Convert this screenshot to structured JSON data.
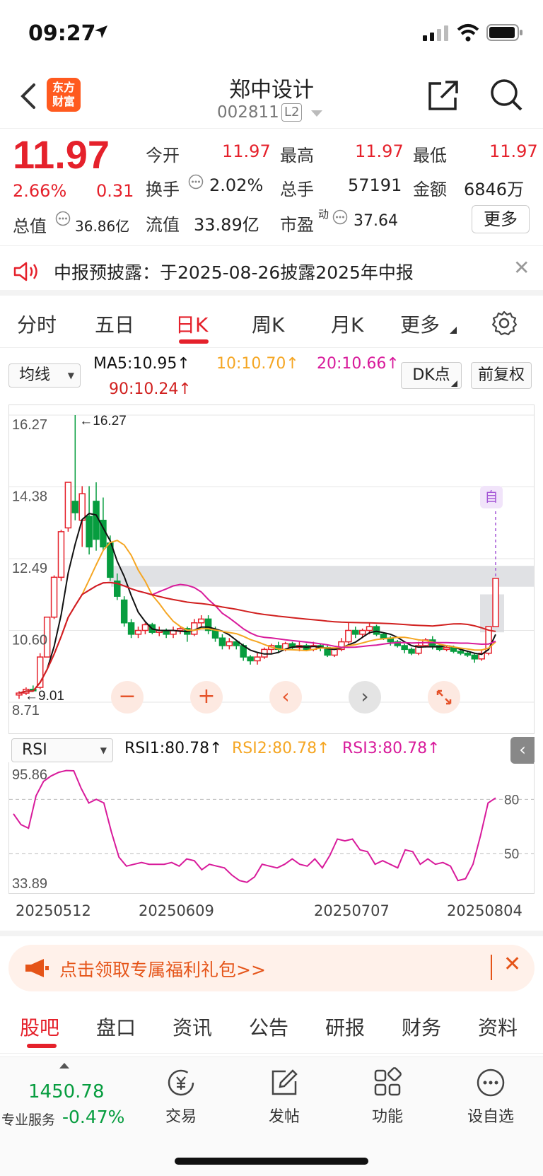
{
  "status": {
    "time": "09:27"
  },
  "header": {
    "title": "郑中设计",
    "code": "002811",
    "level": "L2",
    "logo_line1": "东方",
    "logo_line2": "财富"
  },
  "quote": {
    "price": "11.97",
    "change_pct": "2.66%",
    "change": "0.31",
    "open_label": "今开",
    "open": "11.97",
    "high_label": "最高",
    "high": "11.97",
    "low_label": "最低",
    "low": "11.97",
    "turnover_label": "换手",
    "turnover": "2.02%",
    "volume_label": "总手",
    "volume": "57191",
    "amount_label": "金额",
    "amount": "6846万",
    "total_cap_label": "总值",
    "total_cap": "36.86亿",
    "float_cap_label": "流值",
    "float_cap": "33.89亿",
    "pe_label": "市盈",
    "pe_sup": "动",
    "pe": "37.64",
    "more_label": "更多"
  },
  "notice": {
    "text": "中报预披露：于2025-08-26披露2025年中报"
  },
  "tabs": [
    "分时",
    "五日",
    "日K",
    "周K",
    "月K",
    "更多"
  ],
  "ma": {
    "selector": "均线",
    "ma5": "MA5:10.95↑",
    "ma10": "10:10.70↑",
    "ma20": "20:10.66↑",
    "ma90": "90:10.24↑",
    "dk_label": "DK点",
    "fq_label": "前复权"
  },
  "colors": {
    "up": "#e5212b",
    "down": "#079d3f",
    "ma5": "#111111",
    "ma10": "#f5a623",
    "ma20": "#d81b9b",
    "ma90": "#d1201f"
  },
  "chart_data": [
    {
      "type": "candlestick",
      "title": "",
      "y_ticks": [
        "16.27",
        "14.38",
        "12.49",
        "10.60",
        "8.71"
      ],
      "ylim": [
        8.71,
        16.27
      ],
      "high_mark": "←16.27",
      "low_mark": "←9.01",
      "x_ticks": [
        "20250512",
        "20250609",
        "20250707",
        "20250804"
      ],
      "candles": [
        [
          8.9,
          8.95,
          8.8,
          9.0
        ],
        [
          8.95,
          9.05,
          8.9,
          9.1
        ],
        [
          9.05,
          9.01,
          9.01,
          9.15
        ],
        [
          9.1,
          9.9,
          9.05,
          10.0
        ],
        [
          9.9,
          10.95,
          9.9,
          10.95
        ],
        [
          10.95,
          12.0,
          10.9,
          12.05
        ],
        [
          12.0,
          13.2,
          11.9,
          13.25
        ],
        [
          13.3,
          14.5,
          13.2,
          14.5
        ],
        [
          14.0,
          13.7,
          13.5,
          16.27
        ],
        [
          13.5,
          14.2,
          12.8,
          14.4
        ],
        [
          13.6,
          12.8,
          12.6,
          14.4
        ],
        [
          14.0,
          13.0,
          12.7,
          14.5
        ],
        [
          13.5,
          12.8,
          12.7,
          14.1
        ],
        [
          12.9,
          12.0,
          11.9,
          13.1
        ],
        [
          11.9,
          11.5,
          11.4,
          12.1
        ],
        [
          11.4,
          10.8,
          10.7,
          11.5
        ],
        [
          10.8,
          10.5,
          10.4,
          10.9
        ],
        [
          10.5,
          10.6,
          10.4,
          10.7
        ],
        [
          10.6,
          10.75,
          10.5,
          10.8
        ],
        [
          10.75,
          10.55,
          10.5,
          10.8
        ],
        [
          10.55,
          10.6,
          10.45,
          10.7
        ],
        [
          10.6,
          10.5,
          10.4,
          10.65
        ],
        [
          10.5,
          10.6,
          10.4,
          10.7
        ],
        [
          10.6,
          10.65,
          10.5,
          10.7
        ],
        [
          10.65,
          10.5,
          10.3,
          10.7
        ],
        [
          10.5,
          10.8,
          10.45,
          10.9
        ],
        [
          10.8,
          10.9,
          10.7,
          11.0
        ],
        [
          10.9,
          10.6,
          10.5,
          11.0
        ],
        [
          10.6,
          10.4,
          10.3,
          10.7
        ],
        [
          10.4,
          10.2,
          10.1,
          10.5
        ],
        [
          10.2,
          10.3,
          10.1,
          10.4
        ],
        [
          10.3,
          10.2,
          10.1,
          10.35
        ],
        [
          10.2,
          9.9,
          9.8,
          10.25
        ],
        [
          9.9,
          9.8,
          9.7,
          9.95
        ],
        [
          9.8,
          9.9,
          9.7,
          10.0
        ],
        [
          9.9,
          10.1,
          9.85,
          10.15
        ],
        [
          10.1,
          10.2,
          10.0,
          10.25
        ],
        [
          10.2,
          10.1,
          10.0,
          10.3
        ],
        [
          10.1,
          10.25,
          10.05,
          10.3
        ],
        [
          10.25,
          10.15,
          10.1,
          10.3
        ],
        [
          10.15,
          10.2,
          10.05,
          10.3
        ],
        [
          10.2,
          10.1,
          10.05,
          10.25
        ],
        [
          10.1,
          10.2,
          10.05,
          10.3
        ],
        [
          10.2,
          10.15,
          10.05,
          10.25
        ],
        [
          10.15,
          9.95,
          9.9,
          10.2
        ],
        [
          9.95,
          10.1,
          9.9,
          10.15
        ],
        [
          10.1,
          10.3,
          10.05,
          10.4
        ],
        [
          10.3,
          10.6,
          10.25,
          10.8
        ],
        [
          10.6,
          10.5,
          10.4,
          10.7
        ],
        [
          10.5,
          10.6,
          10.4,
          10.65
        ],
        [
          10.6,
          10.7,
          10.5,
          10.8
        ],
        [
          10.7,
          10.5,
          10.45,
          10.75
        ],
        [
          10.5,
          10.4,
          10.35,
          10.55
        ],
        [
          10.4,
          10.3,
          10.2,
          10.45
        ],
        [
          10.3,
          10.2,
          10.15,
          10.35
        ],
        [
          10.2,
          10.1,
          10.0,
          10.25
        ],
        [
          10.1,
          10.0,
          9.95,
          10.15
        ],
        [
          10.0,
          10.2,
          9.95,
          10.3
        ],
        [
          10.2,
          10.35,
          10.15,
          10.4
        ],
        [
          10.35,
          10.2,
          10.1,
          10.45
        ],
        [
          10.2,
          10.1,
          10.05,
          10.25
        ],
        [
          10.1,
          10.15,
          10.05,
          10.2
        ],
        [
          10.15,
          10.05,
          10.0,
          10.2
        ],
        [
          10.05,
          10.0,
          9.95,
          10.1
        ],
        [
          10.0,
          9.95,
          9.9,
          10.05
        ],
        [
          9.95,
          9.85,
          9.75,
          10.0
        ],
        [
          9.85,
          10.0,
          9.8,
          10.1
        ],
        [
          10.0,
          10.7,
          9.95,
          10.7
        ],
        [
          10.7,
          11.97,
          10.7,
          11.97
        ]
      ]
    },
    {
      "type": "line",
      "title": "",
      "selector": "RSI",
      "rsi1": "RSI1:80.78↑",
      "rsi2": "RSI2:80.78↑",
      "rsi3": "RSI3:80.78↑",
      "y_ticks": [
        "95.86",
        "33.89"
      ],
      "ref_lines": [
        "80",
        "50"
      ],
      "ylim": [
        33.89,
        95.86
      ],
      "values": [
        72,
        66,
        64,
        82,
        90,
        93,
        95,
        96,
        95.86,
        86,
        78,
        80,
        78,
        62,
        48,
        43,
        44,
        45,
        44,
        44,
        44,
        45,
        43,
        47,
        46,
        41,
        44,
        43,
        42,
        38,
        35,
        34,
        37,
        44,
        43,
        42,
        44,
        47,
        44,
        43,
        47,
        42,
        49,
        58,
        57,
        58,
        52,
        51,
        44,
        46,
        44,
        42,
        52,
        51,
        44,
        47,
        44,
        45,
        43,
        35,
        36,
        44,
        60,
        78,
        80.78
      ]
    }
  ],
  "promo": {
    "text": "点击领取专属福利礼包>>"
  },
  "bottom_tabs": [
    "股吧",
    "盘口",
    "资讯",
    "公告",
    "研报",
    "财务",
    "资料"
  ],
  "bottom_bar": {
    "index_value": "1450.78",
    "index_label": "专业服务",
    "index_change": "-0.47%",
    "trade": "交易",
    "post": "发帖",
    "func": "功能",
    "watch": "设自选"
  }
}
